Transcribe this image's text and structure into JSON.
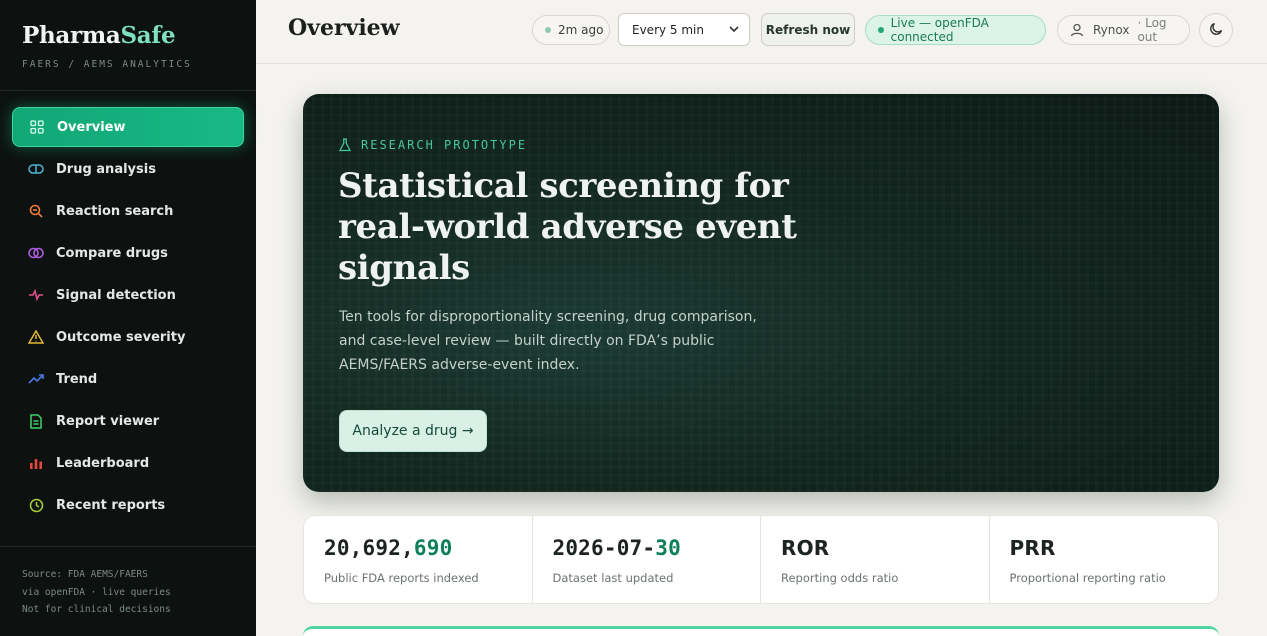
{
  "sidebar": {
    "brand_main": "Pharma",
    "brand_accent": "Safe",
    "brand_sub": "FAERS / AEMS ANALYTICS",
    "items": [
      {
        "label": "Overview",
        "icon": "grid-icon",
        "color": "#ffffff",
        "active": true
      },
      {
        "label": "Drug analysis",
        "icon": "pill-icon",
        "color": "#4ab8d8"
      },
      {
        "label": "Reaction search",
        "icon": "search-icon",
        "color": "#f07c3a"
      },
      {
        "label": "Compare drugs",
        "icon": "compare-icon",
        "color": "#b05ce0"
      },
      {
        "label": "Signal detection",
        "icon": "pulse-icon",
        "color": "#e0508f"
      },
      {
        "label": "Outcome severity",
        "icon": "warning-icon",
        "color": "#e3b832"
      },
      {
        "label": "Trend",
        "icon": "trend-icon",
        "color": "#4c78e6"
      },
      {
        "label": "Report viewer",
        "icon": "document-icon",
        "color": "#3fcf6c"
      },
      {
        "label": "Leaderboard",
        "icon": "bar-chart-icon",
        "color": "#e8463e"
      },
      {
        "label": "Recent reports",
        "icon": "clock-icon",
        "color": "#a8cf3a"
      }
    ],
    "footer": [
      "Source: FDA AEMS/FAERS",
      "via openFDA · live queries",
      "Not for clinical decisions"
    ]
  },
  "header": {
    "title": "Overview",
    "last_refresh": "2m ago",
    "interval_selected": "Every 5 min",
    "refresh_label": "Refresh now",
    "live_status": "Live — openFDA connected",
    "user_name": "Rynox",
    "logout_label": "· Log out"
  },
  "hero": {
    "eyebrow": "RESEARCH PROTOTYPE",
    "title": "Statistical screening for real-world adverse event signals",
    "description": "Ten tools for disproportionality screening, drug comparison, and case-level review — built directly on FDA’s public AEMS/FAERS adverse-event index.",
    "cta_label": "Analyze a drug →"
  },
  "stats": [
    {
      "value_main": "20,692,",
      "value_accent": "690",
      "label": "Public FDA reports indexed"
    },
    {
      "value_main": "2026-07-",
      "value_accent": "30",
      "label": "Dataset last updated"
    },
    {
      "value_main": "ROR",
      "value_accent": "",
      "label": "Reporting odds ratio"
    },
    {
      "value_main": "PRR",
      "value_accent": "",
      "label": "Proportional reporting ratio"
    }
  ],
  "colors": {
    "accent": "#18b884",
    "sidebar_bg": "#0d1210",
    "hero_bg": "#12271f",
    "live_text": "#1a7a55"
  }
}
